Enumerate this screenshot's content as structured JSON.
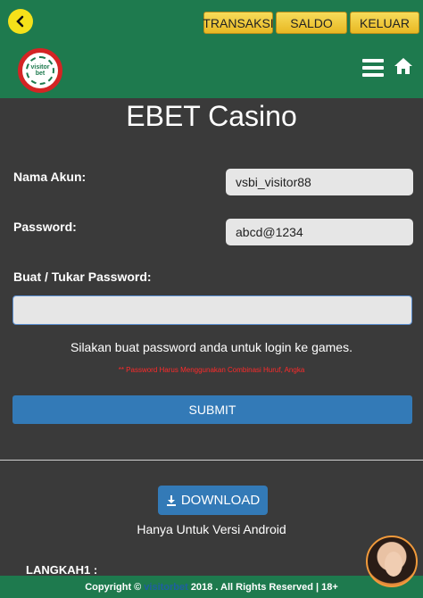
{
  "header": {
    "back_icon": "chevron-left-icon",
    "buttons": [
      "TRANSAKSI",
      "SALDO",
      "KELUAR"
    ],
    "logo_text": "visitor bet",
    "menu_icon": "hamburger-menu-icon",
    "home_icon": "home-icon"
  },
  "main": {
    "title": "EBET Casino",
    "account_label": "Nama Akun:",
    "account_value": "vsbi_visitor88",
    "password_label": "Password:",
    "password_value": "abcd@1234",
    "new_password_label": "Buat / Tukar Password:",
    "new_password_value": "",
    "info_text": "Silakan buat password anda untuk login ke games.",
    "warning_text": "** Password Harus Menggunakan Combinasi Huruf, Angka",
    "submit_label": "SUBMIT"
  },
  "download": {
    "button_label": "DOWNLOAD",
    "icon": "download-icon",
    "note": "Hanya Untuk Versi Android",
    "step_label": "LANGKAH1 :"
  },
  "footer": {
    "prefix": "Copyright ©",
    "brand": "visitorbet",
    "suffix": "2018 . All Rights Reserved | 18+"
  },
  "colors": {
    "header_bg": "#1e7a4e",
    "page_bg": "#3a3a3a",
    "button_blue": "#337ab7",
    "gold_button": "#e8b823",
    "warning_red": "#ff2a2a"
  }
}
